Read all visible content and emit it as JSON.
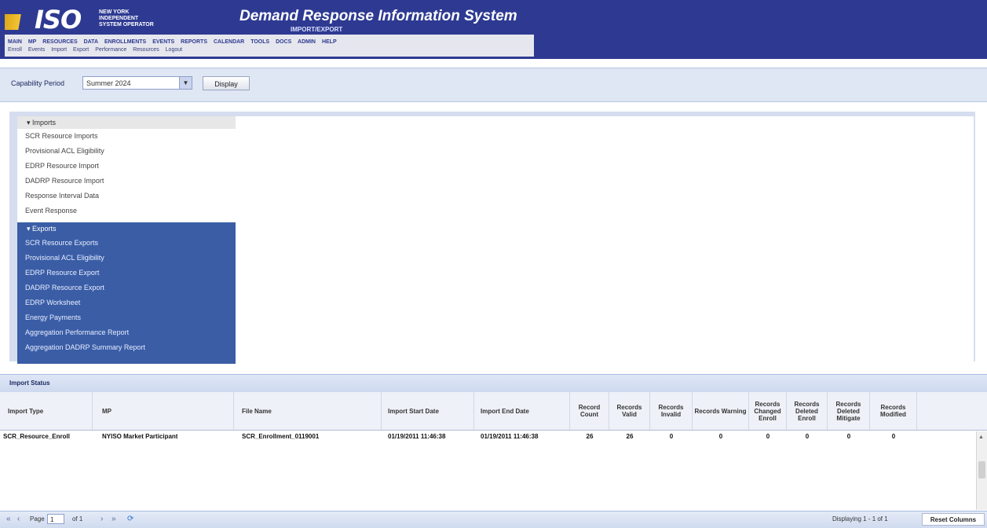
{
  "header": {
    "logo_text": "ISO",
    "logo_sub": [
      "NEW YORK",
      "INDEPENDENT",
      "SYSTEM OPERATOR"
    ],
    "title": "Demand Response Information System",
    "subtitle": "IMPORT/EXPORT"
  },
  "menu": {
    "row1": [
      "MAIN",
      "MP",
      "RESOURCES",
      "DATA",
      "ENROLLMENTS",
      "EVENTS",
      "REPORTS",
      "CALENDAR",
      "TOOLS",
      "DOCS",
      "ADMIN",
      "HELP"
    ],
    "row2": [
      "Enroll",
      "Events",
      "Import",
      "Export",
      "Performance",
      "Resources",
      "Logout"
    ]
  },
  "toolbar": {
    "capability_label": "Capability Period",
    "capability_value": "Summer 2024",
    "display_button": "Display"
  },
  "nav": {
    "imports_header": "Imports",
    "imports": [
      "SCR Resource Imports",
      "Provisional ACL Eligibility",
      "EDRP Resource Import",
      "DADRP Resource Import",
      "Response Interval Data",
      "Event Response"
    ],
    "exports_header": "Exports",
    "exports": [
      "SCR Resource Exports",
      "Provisional ACL Eligibility",
      "EDRP Resource Export",
      "DADRP Resource Export",
      "EDRP Worksheet",
      "Energy Payments",
      "Aggregation Performance Report",
      "Aggregation DADRP Summary Report"
    ]
  },
  "import_status": {
    "title": "Import Status",
    "columns": [
      "Import Type",
      "MP",
      "File Name",
      "Import Start Date",
      "Import End Date",
      "Record Count",
      "Records Valid",
      "Records Invalid",
      "Records Warning",
      "Records Changed Enroll",
      "Records Deleted Enroll",
      "Records Deleted Mitigate",
      "Records Modified"
    ],
    "rows": [
      {
        "import_type": "SCR_Resource_Enroll",
        "mp": "NYISO Market Participant",
        "file_name": "SCR_Enrollment_0119001",
        "start": "01/19/2011 11:46:38",
        "end": "01/19/2011 11:46:38",
        "count": "26",
        "valid": "26",
        "invalid": "0",
        "warning": "0",
        "changed": "0",
        "deleted": "0",
        "mitigated": "0",
        "modified": "0"
      }
    ]
  },
  "footer": {
    "first": "«",
    "prev": "‹",
    "page_label": "Page",
    "page_value": "1",
    "of_label": "of 1",
    "next": "›",
    "last": "»",
    "refresh": "⟳",
    "display_info": "Displaying 1 - 1 of 1",
    "reset_button": "Reset Columns"
  }
}
